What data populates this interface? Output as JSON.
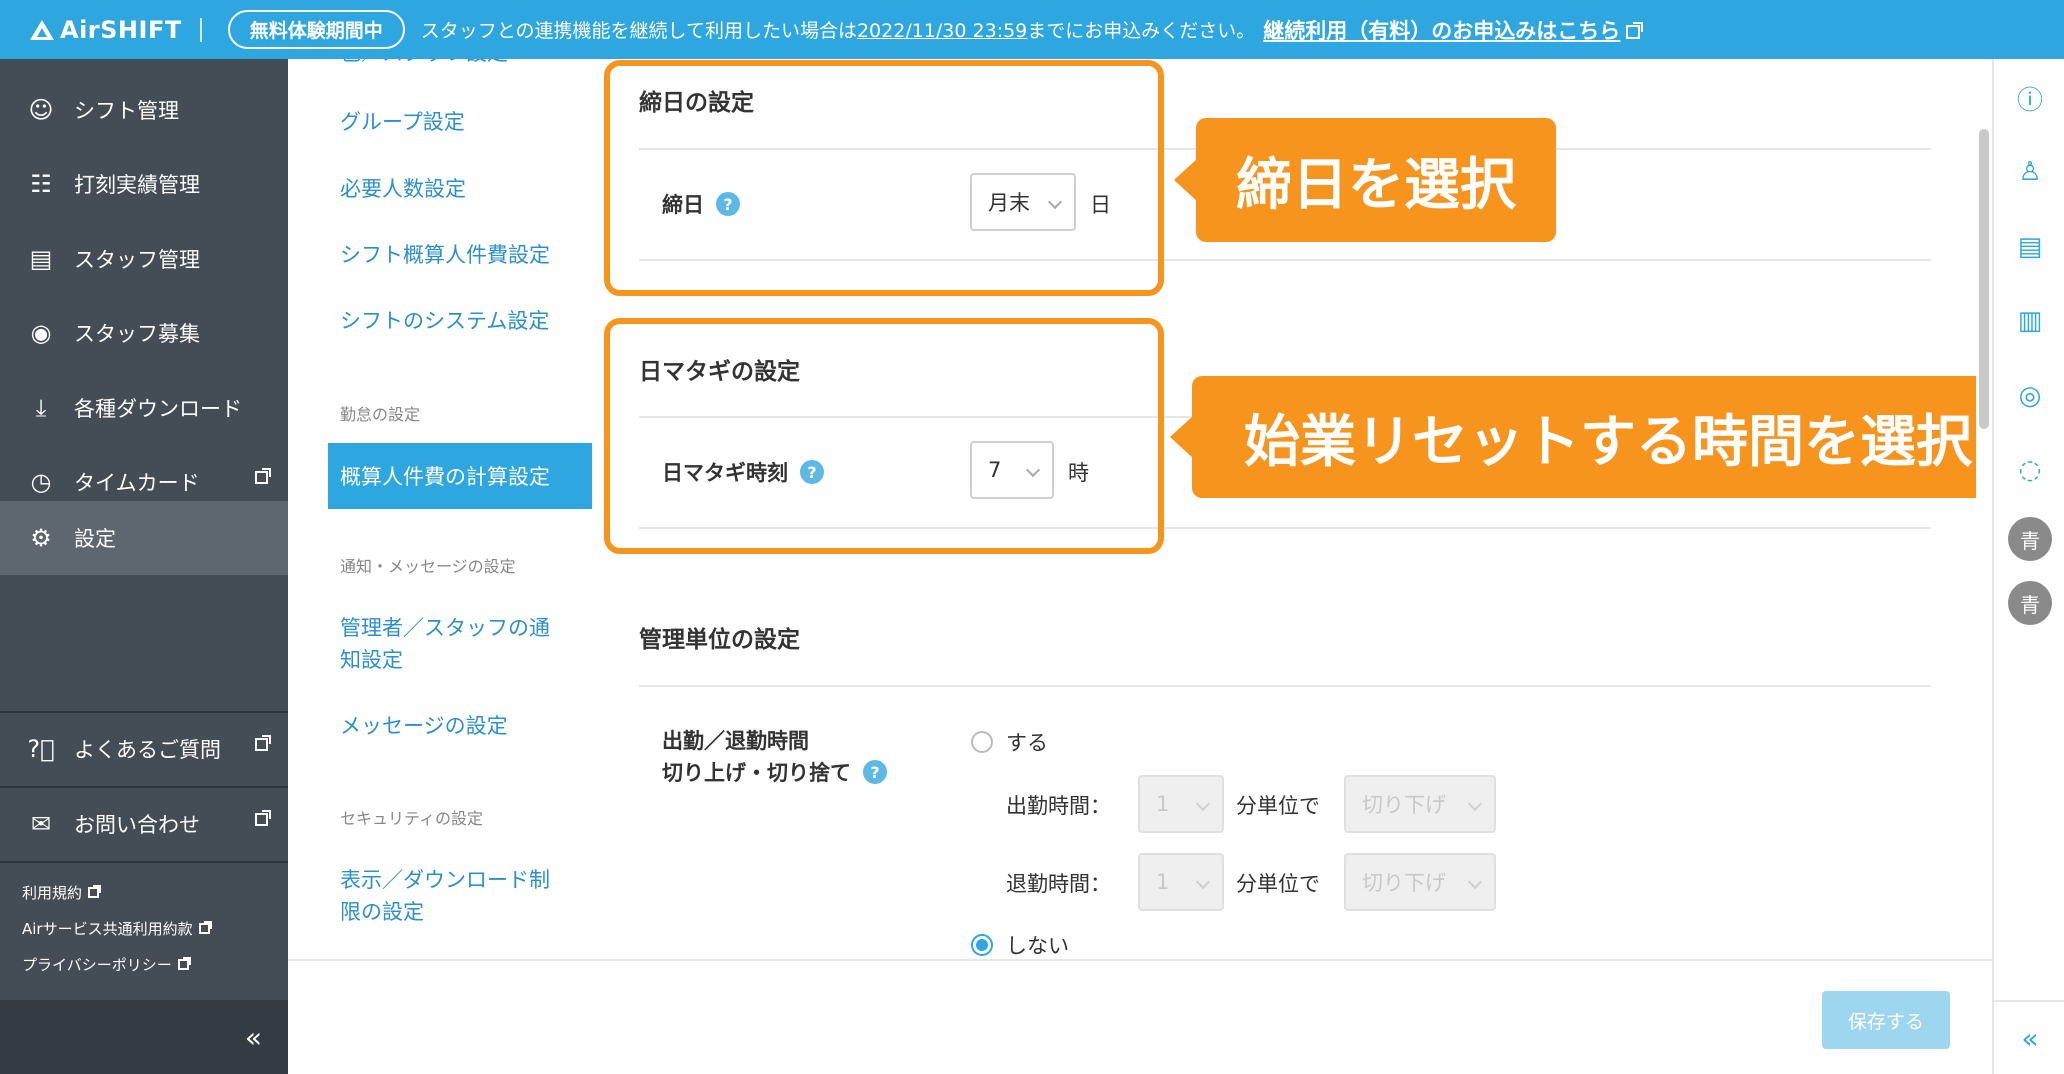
{
  "banner": {
    "logo": "AirSHIFT",
    "trial_badge": "無料体験期間中",
    "message_prefix": "スタッフとの連携機能を継続して利用したい場合は",
    "deadline": "2022/11/30 23:59",
    "message_suffix": "までにお申込みください。",
    "link_label": "継続利用（有料）のお申込みはこちら"
  },
  "sidenav": {
    "items": [
      {
        "label": "シフト管理",
        "icon": "shift-icon"
      },
      {
        "label": "打刻実績管理",
        "icon": "timestamp-icon"
      },
      {
        "label": "スタッフ管理",
        "icon": "staff-card-icon"
      },
      {
        "label": "スタッフ募集",
        "icon": "recruit-icon"
      },
      {
        "label": "各種ダウンロード",
        "icon": "download-icon"
      },
      {
        "label": "タイムカード",
        "icon": "timecard-icon"
      },
      {
        "label": "設定",
        "icon": "gear-icon"
      }
    ],
    "help": [
      {
        "label": "よくあるご質問",
        "icon": "question-icon"
      },
      {
        "label": "お問い合わせ",
        "icon": "mail-icon"
      }
    ],
    "legal": [
      "利用規約",
      "Airサービス共通利用約款",
      "プライバシーポリシー"
    ],
    "collapse_glyph": "«"
  },
  "submenu": {
    "cut_top": "色／スタッフ設定",
    "items_a": [
      "グループ設定",
      "必要人数設定",
      "シフト概算人件費設定",
      "シフトのシステム設定"
    ],
    "head_attendance": "勤怠の設定",
    "active": "概算人件費の計算設定",
    "head_notify": "通知・メッセージの設定",
    "notify_line1": "管理者／スタッフの通",
    "notify_line2": "知設定",
    "message_setting": "メッセージの設定",
    "head_security": "セキュリティの設定",
    "security_line1": "表示／ダウンロード制",
    "security_line2": "限の設定"
  },
  "main": {
    "closing": {
      "title": "締日の設定",
      "label": "締日",
      "value": "月末",
      "unit": "日"
    },
    "daycross": {
      "title": "日マタギの設定",
      "label": "日マタギ時刻",
      "value": "7",
      "unit": "時"
    },
    "management": {
      "title": "管理単位の設定",
      "label_line1": "出勤／退勤時間",
      "label_line2": "切り上げ・切り捨て",
      "option_yes": "する",
      "clock_in_label": "出勤時間：",
      "clock_out_label": "退勤時間：",
      "minutes_value": "1",
      "minutes_unit": "分単位で",
      "rounding_value": "切り下げ",
      "option_no": "しない",
      "selected": "しない"
    }
  },
  "callouts": {
    "closing": "締日を選択",
    "daycross": "始業リセットする時間を選択"
  },
  "footer": {
    "save_label": "保存する"
  },
  "rightrail": {
    "avatar1": "青",
    "avatar2": "青",
    "collapse_glyph": "«"
  },
  "colors": {
    "accent": "#2ea6df",
    "sidebar": "#444c55",
    "highlight": "#f7941d"
  }
}
